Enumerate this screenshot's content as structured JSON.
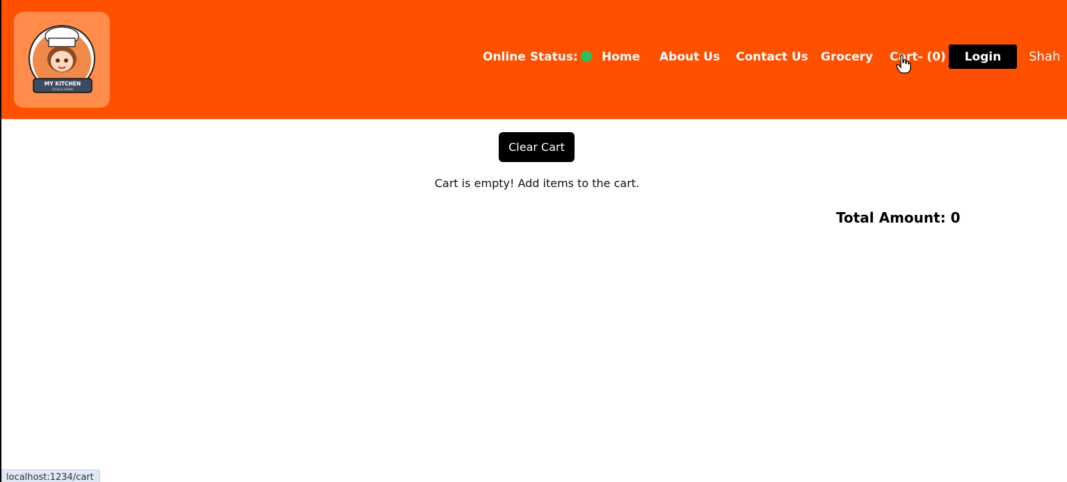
{
  "header": {
    "logo": {
      "title": "MY KITCHEN",
      "subtitle": "FOOD & DRINK"
    },
    "nav": {
      "online_status_label": "Online Status:",
      "online_status_color": "#22c55e",
      "home": "Home",
      "about": "About Us",
      "contact": "Contact Us",
      "grocery": "Grocery",
      "cart": "Cart- (0)",
      "login": "Login",
      "user": "Shah"
    },
    "background_color": "#ff5000"
  },
  "main": {
    "clear_cart_label": "Clear Cart",
    "empty_message": "Cart is empty! Add items to the cart.",
    "total_amount": "Total Amount: 0"
  },
  "status_bar": {
    "url": "localhost:1234/cart"
  }
}
